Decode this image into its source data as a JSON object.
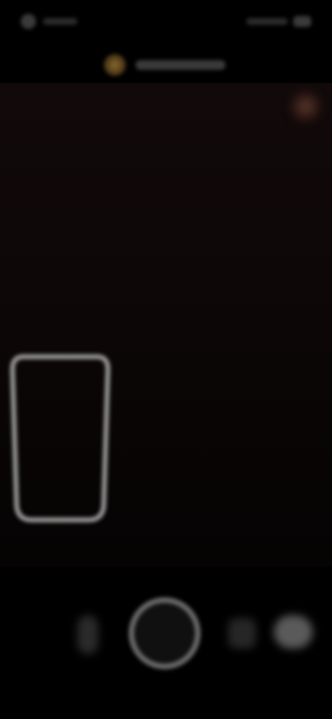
{
  "colors": {
    "background": "#000000",
    "viewfinder_tint": "#120a0a",
    "notif_icon_accent": "#8a6a2e",
    "shutter_ring": "#6a6a6a",
    "frame_outline": "#9a9a9a"
  },
  "icons": {
    "status_left": "profile-dot-icon",
    "status_right": "battery-icon",
    "notification": "app-notification-icon",
    "corner": "light-indicator-icon",
    "thumb": "gallery-frame-icon",
    "left_control": "flash-icon",
    "shutter": "shutter-icon",
    "mid_right_control": "switch-mode-icon",
    "far_right_control": "camera-flip-icon"
  }
}
